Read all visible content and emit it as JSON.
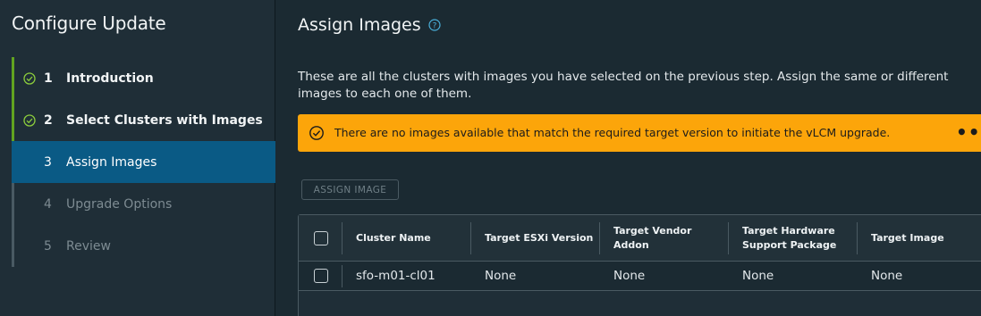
{
  "sidebar": {
    "title": "Configure Update",
    "steps": [
      {
        "num": "1",
        "label": "Introduction",
        "state": "done"
      },
      {
        "num": "2",
        "label": "Select Clusters with Images",
        "state": "done"
      },
      {
        "num": "3",
        "label": "Assign Images",
        "state": "active"
      },
      {
        "num": "4",
        "label": "Upgrade Options",
        "state": "future"
      },
      {
        "num": "5",
        "label": "Review",
        "state": "future"
      }
    ]
  },
  "main": {
    "title": "Assign Images",
    "description": "These are all the clusters with images you have selected on the previous step. Assign the same or different images to each one of them.",
    "alert": {
      "text": "There are no images available that match the required target version to initiate the vLCM upgrade.",
      "more": "•••"
    },
    "assign_button": "ASSIGN IMAGE",
    "table": {
      "columns": [
        "Cluster Name",
        "Target ESXi Version",
        "Target Vendor Addon",
        "Target Hardware Support Package",
        "Target Image"
      ],
      "rows": [
        [
          "sfo-m01-cl01",
          "None",
          "None",
          "None",
          "None"
        ]
      ]
    }
  },
  "colors": {
    "accent_active": "#0a5a85",
    "done_green": "#62a420",
    "warning": "#fca50a"
  }
}
